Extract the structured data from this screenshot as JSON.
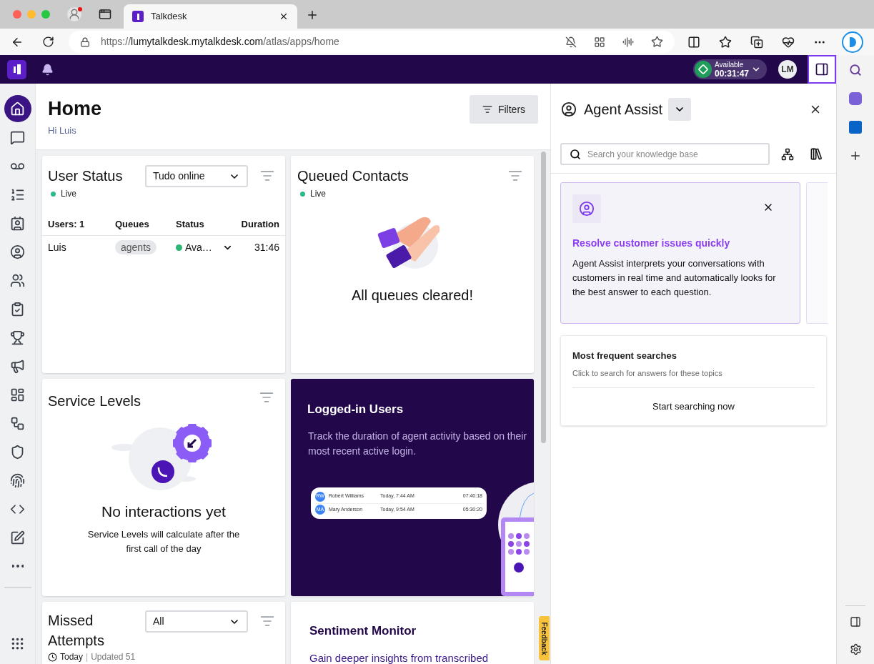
{
  "browser": {
    "tab": {
      "title": "Talkdesk",
      "selected": true
    },
    "url": {
      "scheme": "https://",
      "host": "lumytalkdesk.mytalkdesk.com",
      "path": "/atlas/apps/home"
    }
  },
  "topbar": {
    "status": {
      "label": "Available",
      "timer": "00:31:47"
    },
    "avatar": "LM",
    "panel_toggle": {
      "selected": true
    }
  },
  "nav": {
    "items": [
      {
        "selected": true
      },
      {
        "selected": false
      },
      {
        "selected": false
      },
      {
        "selected": false
      },
      {
        "selected": false
      },
      {
        "selected": false
      },
      {
        "selected": false
      },
      {
        "selected": false
      },
      {
        "selected": false
      },
      {
        "selected": false
      },
      {
        "selected": false
      },
      {
        "selected": false
      },
      {
        "selected": false
      },
      {
        "selected": false
      },
      {
        "selected": false
      },
      {
        "selected": false
      },
      {
        "selected": false
      },
      {
        "selected": false
      }
    ]
  },
  "page": {
    "title": "Home",
    "greeting": "Hi Luis",
    "filters_button": "Filters"
  },
  "user_status": {
    "title": "User Status",
    "live": "Live",
    "select": "Tudo online",
    "columns": [
      "Users: 1",
      "Queues",
      "Status",
      "Duration"
    ],
    "rows": [
      {
        "name": "Luis",
        "queue": "agents",
        "status": "Ava…",
        "color": "#2bb673",
        "duration": "31:46"
      }
    ]
  },
  "queued_contacts": {
    "title": "Queued Contacts",
    "live": "Live",
    "message": "All queues cleared!"
  },
  "service_levels": {
    "title": "Service Levels",
    "message": "No interactions yet",
    "detail": "Service Levels will calculate after the first call of the day"
  },
  "logged_in_users": {
    "title": "Logged-in Users",
    "description": "Track the duration of agent activity based on their most recent active login.",
    "preview_rows": [
      {
        "initials": "RW",
        "name": "Robert Williams",
        "login": "Today, 7:44 AM",
        "duration": "07:40:18"
      },
      {
        "initials": "MA",
        "name": "Mary Anderson",
        "login": "Today, 9:54 AM",
        "duration": "05:30:20"
      }
    ]
  },
  "missed_attempts": {
    "title": "Missed Attempts",
    "select": "All",
    "period": "Today",
    "separator": "|",
    "updated": "Updated 51"
  },
  "sentiment_monitor": {
    "title": "Sentiment Monitor",
    "description": "Gain deeper insights from transcribed"
  },
  "feedback_tab": "Feedback",
  "agent_assist": {
    "title": "Agent Assist",
    "search_placeholder": "Search your knowledge base",
    "tip": {
      "title": "Resolve customer issues quickly",
      "body": "Agent Assist interprets your conversations with customers in real time and automatically looks for the best answer to each question."
    },
    "frequent": {
      "title": "Most frequent searches",
      "subtitle": "Click to search for answers for these topics",
      "button": "Start searching now"
    }
  }
}
